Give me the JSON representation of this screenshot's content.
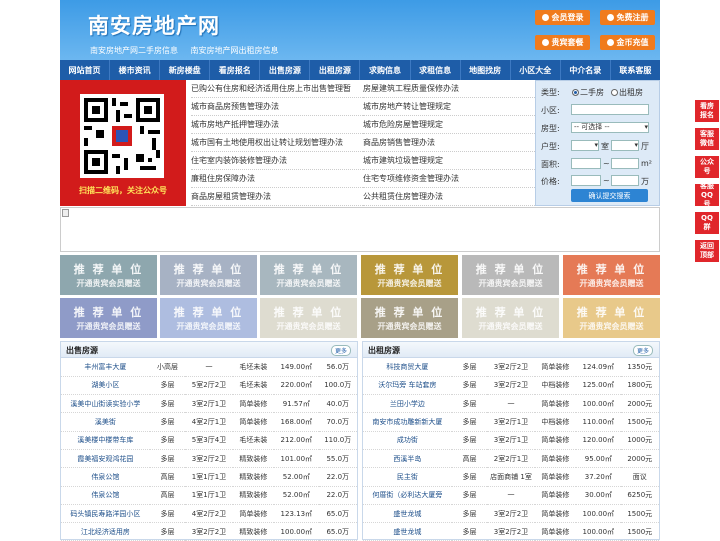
{
  "header": {
    "title": "南安房地产网",
    "sublinks": [
      "南安房地产网二手房信息",
      "南安房地产网出租房信息"
    ],
    "buttons": [
      {
        "label": "会员登录"
      },
      {
        "label": "免费注册"
      },
      {
        "label": "贵宾套餐"
      },
      {
        "label": "金币充值"
      }
    ]
  },
  "nav": [
    "网站首页",
    "楼市资讯",
    "新房楼盘",
    "看房报名",
    "出售房源",
    "出租房源",
    "求购信息",
    "求租信息",
    "地图找房",
    "小区大全",
    "中介名录",
    "联系客服"
  ],
  "qr": {
    "caption": "扫描二维码，关注公众号"
  },
  "links_left": [
    "已购公有住房和经济适用住房上市出售管理暂",
    "城市商品房预售管理办法",
    "城市房地产抵押管理办法",
    "城市国有土地使用权出让转让规划管理办法",
    "住宅室内装饰装修管理办法",
    "廉租住房保障办法",
    "商品房屋租赁管理办法"
  ],
  "links_right": [
    "房屋建筑工程质量保修办法",
    "城市房地产转让管理规定",
    "城市危险房屋管理规定",
    "商品房销售管理办法",
    "城市建筑垃圾管理规定",
    "住宅专项维修资金管理办法",
    "公共租赁住房管理办法"
  ],
  "search": {
    "type_label": "类型:",
    "opt1": "二手房",
    "opt2": "出租房",
    "area_label": "小区:",
    "kind_label": "房型:",
    "kind_value": "-- 可选择 --",
    "room_label": "户型:",
    "room_unit1": "室",
    "room_unit2": "厅",
    "size_label": "面积:",
    "size_sep": "~",
    "size_unit": "m²",
    "price_label": "价格:",
    "price_sep": "~",
    "price_unit": "万",
    "submit": "确认提交搜索"
  },
  "tiles": {
    "line1": "推 荐 单 位",
    "line2": "开通贵宾会员赠送",
    "colors": [
      "#8ea7ae",
      "#a7b2c4",
      "#a8b7bf",
      "#b8973a",
      "#b9b9b9",
      "#e57a56",
      "#8f9bc8",
      "#aebde0",
      "#dedcd0",
      "#a8a088",
      "#dedcd0",
      "#e8c98a"
    ]
  },
  "sale": {
    "title": "出售房源",
    "more": "更多",
    "rows": [
      [
        "丰州富丰大厦",
        "小高层",
        "一",
        "毛坯未装",
        "149.00㎡",
        "56.0万"
      ],
      [
        "湖美小区",
        "多层",
        "5室2厅2卫",
        "毛坯未装",
        "220.00㎡",
        "100.0万"
      ],
      [
        "溪美中山街读实验小学",
        "多层",
        "3室2厅1卫",
        "简单装修",
        "91.57㎡",
        "40.0万"
      ],
      [
        "溪美街",
        "多层",
        "4室2厅1卫",
        "简单装修",
        "168.00㎡",
        "70.0万"
      ],
      [
        "溪美楼中楼带车库",
        "多层",
        "5室3厅4卫",
        "毛坯未装",
        "212.00㎡",
        "110.0万"
      ],
      [
        "霞美福安观鸿花园",
        "多层",
        "3室2厅2卫",
        "精致装修",
        "101.00㎡",
        "55.0万"
      ],
      [
        "伟泉公馆",
        "高层",
        "1室1厅1卫",
        "精致装修",
        "52.00㎡",
        "22.0万"
      ],
      [
        "伟泉公馆",
        "高层",
        "1室1厅1卫",
        "精致装修",
        "52.00㎡",
        "22.0万"
      ],
      [
        "码头镇民寿路洋园小区",
        "多层",
        "4室2厅2卫",
        "简单装修",
        "123.13㎡",
        "65.0万"
      ],
      [
        "江北经济适用房",
        "多层",
        "3室2厅2卫",
        "精致装修",
        "100.00㎡",
        "65.0万"
      ]
    ]
  },
  "rent": {
    "title": "出租房源",
    "more": "更多",
    "rows": [
      [
        "科技商贸大厦",
        "多层",
        "3室2厅2卫",
        "简单装修",
        "124.09㎡",
        "1350元"
      ],
      [
        "沃尔玛旁 车站套房",
        "多层",
        "3室2厅2卫",
        "中档装修",
        "125.00㎡",
        "1800元"
      ],
      [
        "兰田小学边",
        "多层",
        "一",
        "简单装修",
        "100.00㎡",
        "2000元"
      ],
      [
        "南安市成功雕新新大厦",
        "多层",
        "3室2厅1卫",
        "中档装修",
        "110.00㎡",
        "1500元"
      ],
      [
        "成功街",
        "多层",
        "3室2厅1卫",
        "简单装修",
        "120.00㎡",
        "1000元"
      ],
      [
        "西溪半岛",
        "高层",
        "2室2厅1卫",
        "简单装修",
        "95.00㎡",
        "2000元"
      ],
      [
        "民主街",
        "多层",
        "店面商铺",
        "1室",
        "简单装修",
        "37.20㎡",
        "面议"
      ],
      [
        "何厝街（必利达大厦旁",
        "多层",
        "一",
        "简单装修",
        "30.00㎡",
        "6250元"
      ],
      [
        "盛世龙城",
        "多层",
        "3室2厅2卫",
        "简单装修",
        "100.00㎡",
        "1500元"
      ],
      [
        "盛世龙城",
        "多层",
        "3室2厅2卫",
        "简单装修",
        "100.00㎡",
        "1500元"
      ]
    ]
  },
  "float": [
    "看房报名",
    "客服微信",
    "公众号",
    "客服QQ号",
    "QQ群",
    "返回顶部"
  ]
}
